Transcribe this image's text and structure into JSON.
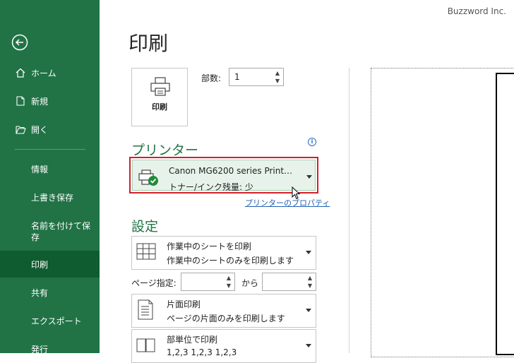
{
  "brand": "Buzzword Inc.",
  "page_title": "印刷",
  "sidebar": {
    "back_icon": "back-arrow-icon",
    "items": [
      {
        "label": "ホーム",
        "icon": "home-icon"
      },
      {
        "label": "新規",
        "icon": "new-file-icon"
      },
      {
        "label": "開く",
        "icon": "open-folder-icon"
      },
      {
        "label": "情報"
      },
      {
        "label": "上書き保存"
      },
      {
        "label": "名前を付けて保存"
      },
      {
        "label": "印刷",
        "active": true
      },
      {
        "label": "共有"
      },
      {
        "label": "エクスポート"
      },
      {
        "label": "発行"
      }
    ]
  },
  "print_button": {
    "label": "印刷",
    "icon": "printer-icon"
  },
  "copies": {
    "label": "部数:",
    "value": "1"
  },
  "printer": {
    "section_title": "プリンター",
    "info_icon": "i",
    "name": "Canon MG6200 series Print…",
    "status": "トナー/インク残量: 少",
    "properties_link": "プリンターのプロパティ"
  },
  "settings": {
    "section_title": "設定",
    "print_what": {
      "line1": "作業中のシートを印刷",
      "line2": "作業中のシートのみを印刷します",
      "icon": "sheet-grid-icon"
    },
    "pages": {
      "label": "ページ指定:",
      "from_value": "",
      "to_label": "から",
      "to_value": ""
    },
    "sides": {
      "line1": "片面印刷",
      "line2": "ページの片面のみを印刷します",
      "icon": "one-sided-icon"
    },
    "collate": {
      "line1": "部単位で印刷",
      "line2": "1,2,3    1,2,3    1,2,3",
      "icon": "collate-icon"
    }
  },
  "colors": {
    "sidebar": "#217346",
    "active": "#0e5c2f",
    "highlight": "#d0202a"
  }
}
